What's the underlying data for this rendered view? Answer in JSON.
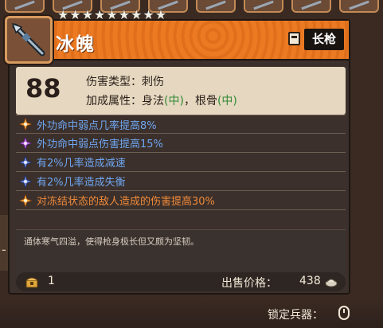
{
  "header": {
    "weapon_name": "冰魄",
    "weapon_type": "长枪",
    "stars": 9,
    "weapon_icon": "spear-icon",
    "type_icon": "scroll-icon"
  },
  "stats": {
    "score": "88",
    "damage_type_label": "伤害类型：",
    "damage_type_value": "刺伤",
    "attr_label": "加成属性：",
    "attr_1": "身法",
    "attr_1_grade": "(中)",
    "separator": "，",
    "attr_2": "根骨",
    "attr_2_grade": "(中)"
  },
  "effects": [
    {
      "icon": "orange-shuriken-icon",
      "text": "外功命中弱点几率提高8%",
      "color": "#6fa6f2"
    },
    {
      "icon": "purple-shuriken-icon",
      "text": "外功命中弱点伤害提高15%",
      "color": "#6fa6f2"
    },
    {
      "icon": "blue-shuriken-icon",
      "text": "有2%几率造成减速",
      "color": "#6fa6f2"
    },
    {
      "icon": "blue-shuriken-icon",
      "text": "有2%几率造成失衡",
      "color": "#6fa6f2"
    },
    {
      "icon": "orange-shuriken-icon",
      "text": "对冻结状态的敌人造成的伤害提高30%",
      "color": "#f08a3a"
    }
  ],
  "description": "通体寒气四溢，使得枪身极长但又颇为坚韧。",
  "footer": {
    "quantity": "1",
    "sell_label": "出售价格：",
    "sell_price": "438",
    "chest_icon": "chest-icon",
    "coin_icon": "coin-icon"
  },
  "lock": {
    "label": "锁定兵器：",
    "icon": "mouse-icon"
  },
  "colors": {
    "header_orange": "#ec7a22",
    "effect_blue": "#6fa6f2",
    "effect_orange": "#f08a3a",
    "grade_green": "#2f8a34"
  }
}
